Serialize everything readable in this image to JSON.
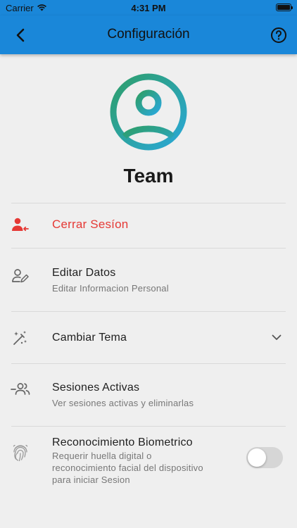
{
  "status_bar": {
    "carrier": "Carrier",
    "time": "4:31 PM"
  },
  "app_bar": {
    "title": "Configuración",
    "back_icon": "arrow-back-icon",
    "help_icon": "help-circle-icon"
  },
  "profile": {
    "name": "Team",
    "avatar_icon": "account-circle-icon"
  },
  "settings": {
    "logout": {
      "label": "Cerrar Sesíon",
      "icon": "person-remove-icon"
    },
    "edit_data": {
      "label": "Editar Datos",
      "description": "Editar Informacion Personal",
      "icon": "person-edit-icon"
    },
    "theme": {
      "label": "Cambiar Tema",
      "icon": "theme-wand-icon"
    },
    "sessions": {
      "label": "Sesiones Activas",
      "description": "Ver sesiones activas y eliminarlas",
      "icon": "people-icon"
    },
    "biometric": {
      "label": "Reconocimiento Biometrico",
      "description_line1": "Requerir huella digital o",
      "description_line2": "reconocimiento facial del dispositivo",
      "description_line3": "para iniciar Sesion",
      "icon": "fingerprint-icon",
      "enabled": false
    }
  },
  "colors": {
    "app_bar": "#1a87d9",
    "danger": "#e53935",
    "avatar_gradient_start": "#2e9e6a",
    "avatar_gradient_end": "#2aa8d8"
  }
}
